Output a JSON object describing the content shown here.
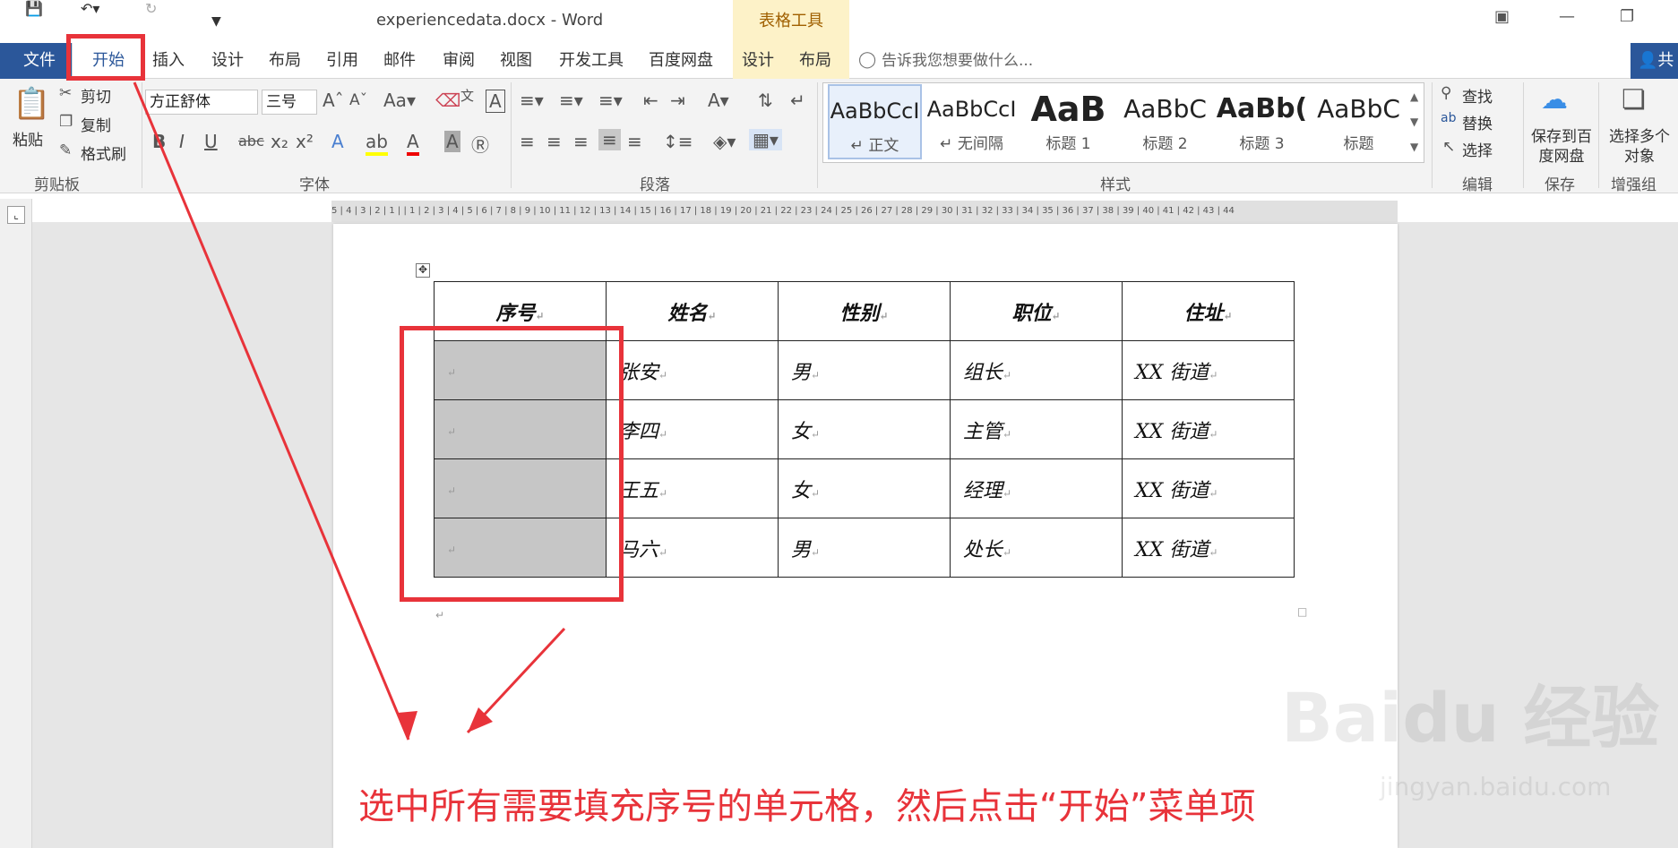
{
  "titlebar": {
    "document_title": "experiencedata.docx - Word",
    "table_tools": "表格工具"
  },
  "menu": {
    "file": "文件",
    "tabs": [
      "开始",
      "插入",
      "设计",
      "布局",
      "引用",
      "邮件",
      "审阅",
      "视图",
      "开发工具",
      "百度网盘",
      "设计",
      "布局"
    ],
    "tell_me": "告诉我您想要做什么...",
    "share": "共"
  },
  "clipboard": {
    "paste": "粘贴",
    "cut": "剪切",
    "copy": "复制",
    "format_painter": "格式刷",
    "label": "剪贴板"
  },
  "font": {
    "family": "方正舒体",
    "size": "三号",
    "label": "字体"
  },
  "paragraph": {
    "label": "段落"
  },
  "styles": {
    "items": [
      {
        "sample": "AaBbCcI",
        "name": "↵ 正文"
      },
      {
        "sample": "AaBbCcI",
        "name": "↵ 无间隔"
      },
      {
        "sample": "AaB",
        "name": "标题 1"
      },
      {
        "sample": "AaBbC",
        "name": "标题 2"
      },
      {
        "sample": "AaBb(",
        "name": "标题 3"
      },
      {
        "sample": "AaBbC",
        "name": "标题"
      }
    ],
    "label": "样式"
  },
  "editing": {
    "find": "查找",
    "replace": "替换",
    "select": "选择",
    "label": "编辑"
  },
  "save": {
    "button": "保存到百度网盘",
    "label": "保存"
  },
  "enhance": {
    "button": "选择多个对象",
    "label": "增强组"
  },
  "ruler": "5 | 4 | 3 | 2 | 1 |   | 1 | 2 | 3 | 4 | 5 | 6 | 7 | 8 | 9 | 10 | 11 | 12 | 13 | 14 | 15 | 16 | 17 | 18 | 19 | 20 | 21 | 22 | 23 | 24 | 25 | 26 | 27 | 28 | 29 | 30 | 31 | 32 | 33 | 34 | 35 | 36 | 37 | 38 | 39 | 40 | 41 | 42 | 43 | 44",
  "table": {
    "headers": [
      "序号",
      "姓名",
      "性别",
      "职位",
      "住址"
    ],
    "rows": [
      [
        "",
        "张安",
        "男",
        "组长",
        "XX 街道"
      ],
      [
        "",
        "李四",
        "女",
        "主管",
        "XX 街道"
      ],
      [
        "",
        "王五",
        "女",
        "经理",
        "XX 街道"
      ],
      [
        "",
        "马六",
        "男",
        "处长",
        "XX 街道"
      ]
    ]
  },
  "annotation": "选中所有需要填充序号的单元格，然后点击“开始”菜单项",
  "watermark": "Baidu 经验",
  "watermark_url": "jingyan.baidu.com",
  "colors": {
    "accent": "#2b579a",
    "annotation": "#e8333a",
    "selection": "#c6c6c6"
  }
}
